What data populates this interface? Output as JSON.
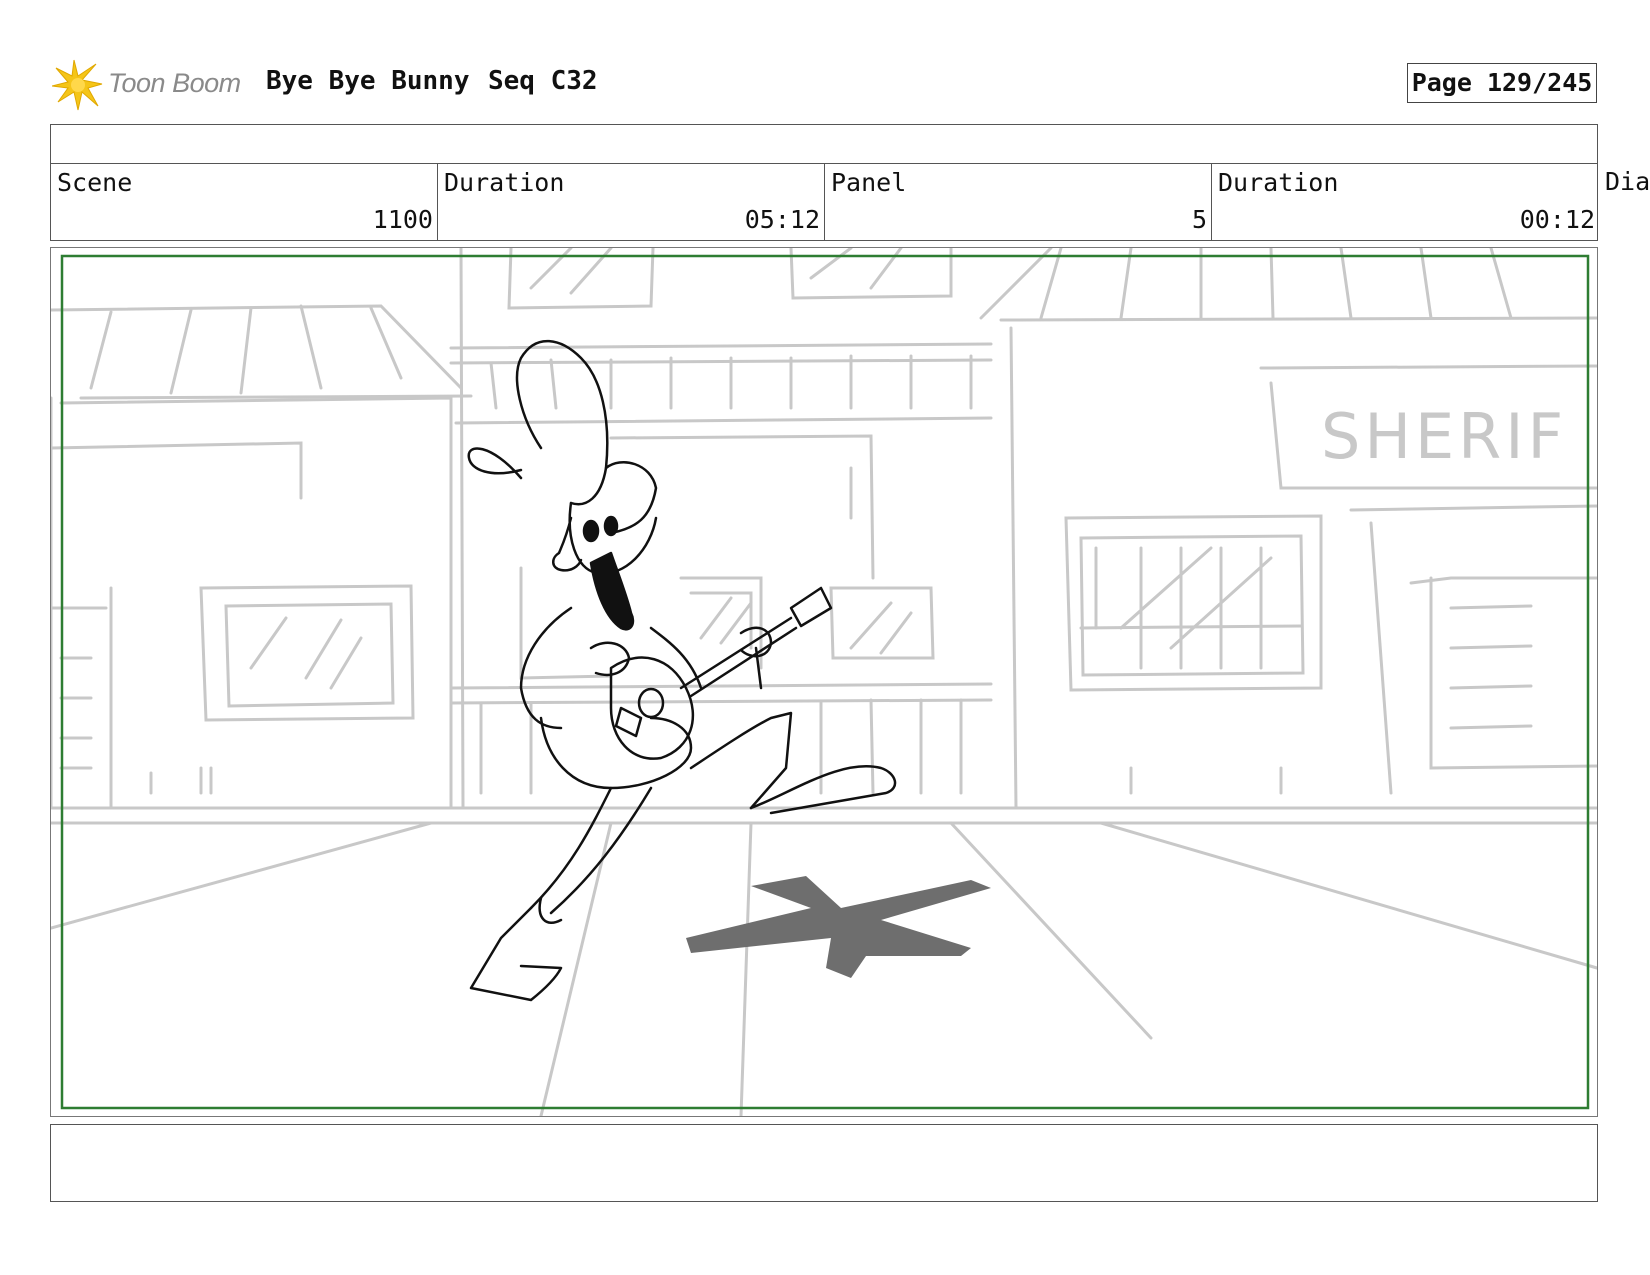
{
  "header": {
    "logo_text": "Toon Boom",
    "project_title": "Bye Bye Bunny",
    "sequence": "Seq C32",
    "page": "Page 129/245"
  },
  "info": {
    "scene_label": "Scene",
    "scene_value": "1100",
    "scene_duration_label": "Duration",
    "scene_duration_value": "05:12",
    "panel_label": "Panel",
    "panel_value": "5",
    "panel_duration_label": "Duration",
    "panel_duration_value": "00:12",
    "dialogue_label_cut": "Dia"
  },
  "panel": {
    "sign_text": "SHERIF",
    "frame_color": "#2e7d32",
    "sketch_color": "#c8c8c8",
    "shadow_color": "#6e6e6e"
  },
  "action_notes": ""
}
